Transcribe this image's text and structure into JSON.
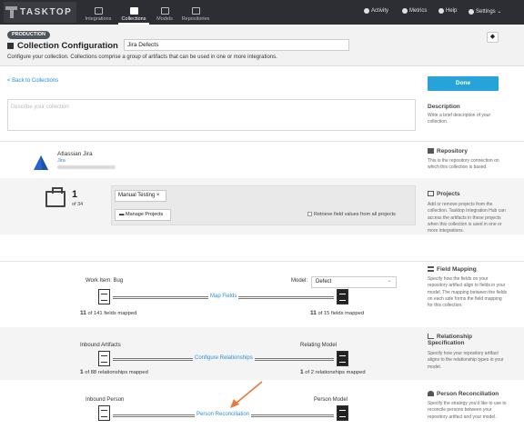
{
  "topnav": {
    "logo": "TASKTOP",
    "items": [
      {
        "label": "Integrations"
      },
      {
        "label": "Collections"
      },
      {
        "label": "Models"
      },
      {
        "label": "Repositories"
      }
    ],
    "right": [
      {
        "label": "Activity"
      },
      {
        "label": "Metrics"
      },
      {
        "label": "Help"
      },
      {
        "label": "Settings ⌄"
      }
    ]
  },
  "header": {
    "badge": "PRODUCTION",
    "title": "Collection Configuration",
    "name_value": "Jira Defects",
    "subtitle": "Configure your collection. Collections comprise a group of artifacts that can be used in one or more integrations."
  },
  "actions": {
    "back": "< Back to Collections",
    "done": "Done"
  },
  "description": {
    "placeholder": "Describe your collection",
    "title": "Description",
    "help": "Write a brief description of your collection."
  },
  "repository": {
    "name": "Atlassian Jira",
    "type": "Jira",
    "title": "Repository",
    "help": "This is the repository connection on which this collection is based."
  },
  "projects": {
    "count": "1",
    "of": "of 34",
    "tag": "Manual Testing ×",
    "manage": "Manage Projects",
    "retrieve": "Retrieve field values from all projects",
    "title": "Projects",
    "help": "Add or remove projects from the collection. Tasktop Integration Hub can access the artifacts in these projects when this collection is used in one or more integrations."
  },
  "field_mapping": {
    "work_item": "Work Item: Bug",
    "model_label": "Model:",
    "model_value": "Defect",
    "link": "Map Fields",
    "left_num": "11",
    "left_text": "of 141 fields mapped",
    "right_num": "11",
    "right_text": "of 15 fields mapped",
    "title": "Field Mapping",
    "help": "Specify how the fields on your repository artifact align to fields in your model. The mapping between the fields on each side forms the field mapping for this collection."
  },
  "relationships": {
    "left_label": "Inbound Artifacts",
    "right_label": "Relating Model",
    "link": "Configure Relationships",
    "left_num": "1",
    "left_text": "of 88 relationships mapped",
    "right_num": "1",
    "right_text": "of 2 relationships mapped",
    "title": "Relationship Specification",
    "help": "Specify how your repository artifact aligns to the relationship types in your model."
  },
  "person": {
    "left_label": "Inbound Person",
    "right_label": "Person Model",
    "link": "Person Reconciliation",
    "title": "Person Reconciliation",
    "help": "Specify the strategy you'd like to use to reconcile persons between your repository artifact and your model."
  },
  "colors": {
    "accent": "#26a3d9",
    "link": "#2a8fd8",
    "annotation_arrow": "#e8793a",
    "nav_bg": "#2d2e33"
  }
}
